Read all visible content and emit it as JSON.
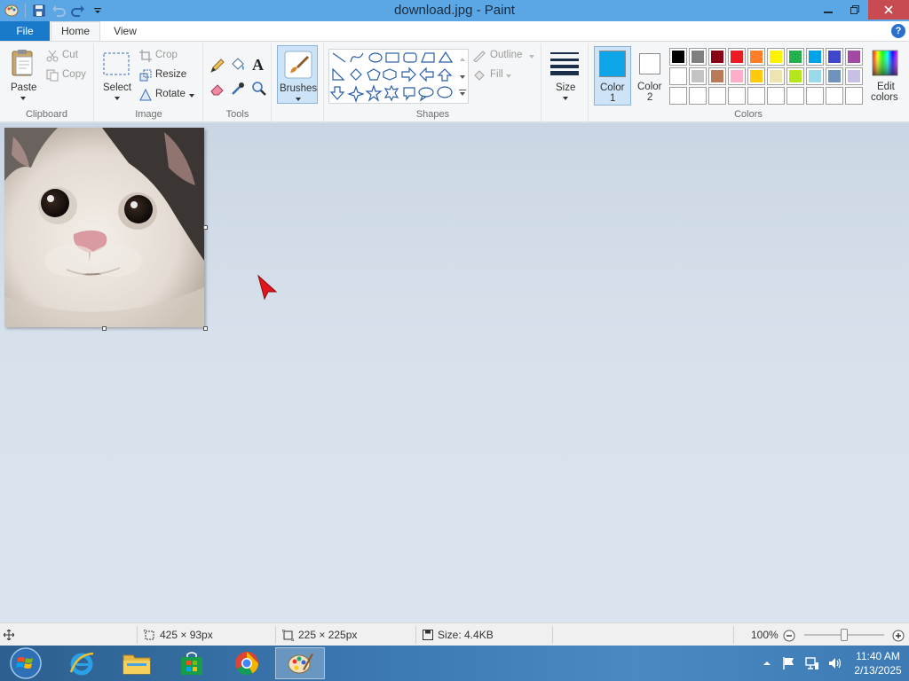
{
  "window": {
    "title": "download.jpg - Paint"
  },
  "tabs": {
    "file": "File",
    "home": "Home",
    "view": "View",
    "help": "?"
  },
  "clipboard": {
    "paste": "Paste",
    "cut": "Cut",
    "copy": "Copy",
    "group": "Clipboard"
  },
  "image_group": {
    "select": "Select",
    "crop": "Crop",
    "resize": "Resize",
    "rotate": "Rotate",
    "group": "Image"
  },
  "tools": {
    "group": "Tools",
    "text_glyph": "A"
  },
  "brushes": {
    "label": "Brushes"
  },
  "shapes": {
    "outline": "Outline",
    "fill": "Fill",
    "group": "Shapes"
  },
  "size": {
    "label": "Size"
  },
  "colors": {
    "color1_line1": "Color",
    "color1_line2": "1",
    "color2_line1": "Color",
    "color2_line2": "2",
    "edit_line1": "Edit",
    "edit_line2": "colors",
    "group": "Colors",
    "color1_value": "#0ea5e9",
    "color2_value": "#ffffff",
    "palette_row1": [
      "#000000",
      "#7f7f7f",
      "#880015",
      "#ed1c24",
      "#ff7f27",
      "#fff200",
      "#22b14c",
      "#00a2e8",
      "#3f48cc",
      "#a349a4"
    ],
    "palette_row2": [
      "#ffffff",
      "#c3c3c3",
      "#b97a57",
      "#ffaec9",
      "#ffc90e",
      "#efe4b0",
      "#b5e61d",
      "#99d9ea",
      "#7092be",
      "#c8bfe7"
    ]
  },
  "status": {
    "cursor_pos": "425 × 93px",
    "image_dims": "225 × 225px",
    "file_size": "Size: 4.4KB",
    "zoom": "100%",
    "zoom_level": 0.5
  },
  "taskbar": {
    "time": "11:40 AM",
    "date": "2/13/2025"
  }
}
